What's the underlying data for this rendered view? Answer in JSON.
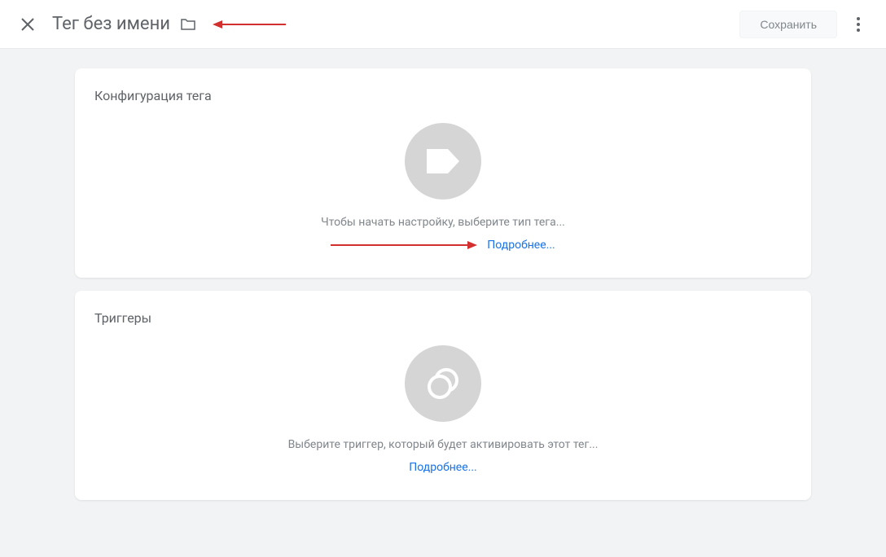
{
  "header": {
    "title": "Тег без имени",
    "save_label": "Сохранить"
  },
  "config_card": {
    "title": "Конфигурация тега",
    "hint": "Чтобы начать настройку, выберите тип тега...",
    "details_link": "Подробнее..."
  },
  "triggers_card": {
    "title": "Триггеры",
    "hint": "Выберите триггер, который будет активировать этот тег...",
    "details_link": "Подробнее..."
  }
}
